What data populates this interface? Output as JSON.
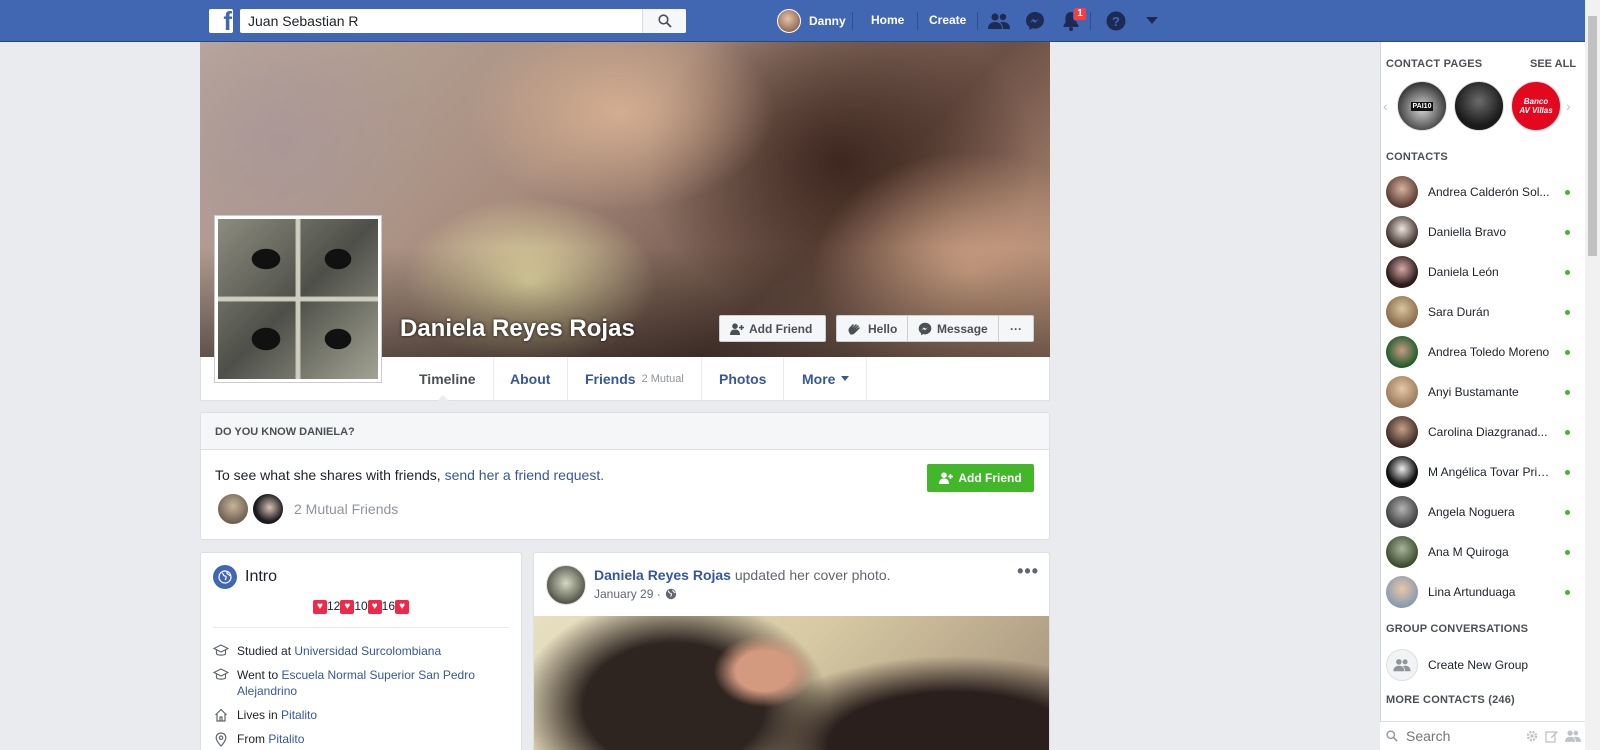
{
  "topbar": {
    "logo": "f",
    "search_value": "Juan Sebastian R",
    "user_name": "Danny",
    "home": "Home",
    "create": "Create",
    "notifications_count": "1",
    "brand_color": "#4267b2"
  },
  "profile": {
    "name": "Daniela Reyes Rojas",
    "add_friend": "Add Friend",
    "hello": "Hello",
    "message": "Message",
    "more": "···"
  },
  "tabs": {
    "timeline": "Timeline",
    "about": "About",
    "friends": "Friends",
    "friends_sub": "2 Mutual",
    "photos": "Photos",
    "more": "More"
  },
  "know": {
    "heading": "DO YOU KNOW DANIELA?",
    "text": "To see what she shares with friends, ",
    "link": "send her a friend request.",
    "mutual": "2 Mutual Friends",
    "button": "Add Friend"
  },
  "intro": {
    "title": "Intro",
    "hearts": [
      "12",
      "10",
      "16"
    ],
    "studied_prefix": "Studied at ",
    "studied_link": "Universidad Surcolombiana",
    "went_prefix": "Went to ",
    "went_link": "Escuela Normal Superior San Pedro Alejandrino",
    "lives_prefix": "Lives in ",
    "lives_link": "Pitalito",
    "from_prefix": "From ",
    "from_link": "Pitalito"
  },
  "post": {
    "author": "Daniela Reyes Rojas",
    "action": " updated her cover photo.",
    "date": "January 29 ·",
    "more": "•••"
  },
  "sidebar": {
    "contact_pages": "CONTACT PAGES",
    "see_all": "SEE ALL",
    "pages": [
      {
        "label": "PAI10"
      },
      {
        "label": ""
      },
      {
        "label": "Banco AV Villas"
      }
    ],
    "contacts_heading": "CONTACTS",
    "contacts": [
      {
        "name": "Andrea Calderón Sol..."
      },
      {
        "name": "Daniella Bravo"
      },
      {
        "name": "Daniela León"
      },
      {
        "name": "Sara Durán"
      },
      {
        "name": "Andrea Toledo Moreno"
      },
      {
        "name": "Anyi Bustamante"
      },
      {
        "name": "Carolina Diazgranad..."
      },
      {
        "name": "M Angélica Tovar Prieto"
      },
      {
        "name": "Angela Noguera"
      },
      {
        "name": "Ana M Quiroga"
      },
      {
        "name": "Lina Artunduaga"
      }
    ],
    "group_heading": "GROUP CONVERSATIONS",
    "create_group": "Create New Group",
    "more_contacts": "MORE CONTACTS (246)",
    "search_placeholder": "Search"
  }
}
